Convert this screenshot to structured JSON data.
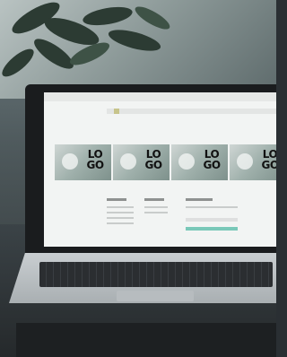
{
  "scene": {
    "description_free": true
  },
  "logo_tiles": [
    {
      "text": "LO GO"
    },
    {
      "text": "LO GO"
    },
    {
      "text": "LO GO"
    },
    {
      "text": "LO GO"
    }
  ],
  "colors": {
    "accent": "#79c8b8",
    "lid": "#1a1c1e",
    "screen_bg": "#f2f4f3"
  },
  "icons": [
    "menu-dot"
  ]
}
